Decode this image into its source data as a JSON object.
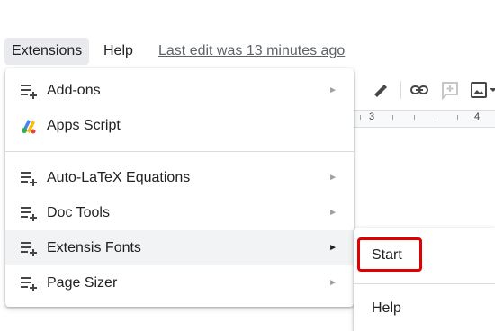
{
  "menubar": {
    "extensions": "Extensions",
    "help": "Help",
    "last_edit": "Last edit was 13 minutes ago"
  },
  "ruler": {
    "mark_3": "3",
    "mark_4": "4"
  },
  "menu": {
    "items": [
      {
        "label": "Add-ons",
        "icon": "add-ons-icon",
        "submenu": true
      },
      {
        "label": "Apps Script",
        "icon": "apps-script-icon",
        "submenu": false
      },
      {
        "label": "Auto-LaTeX Equations",
        "icon": "add-on-list-icon",
        "submenu": true
      },
      {
        "label": "Doc Tools",
        "icon": "add-on-list-icon",
        "submenu": true
      },
      {
        "label": "Extensis Fonts",
        "icon": "add-on-list-icon",
        "submenu": true,
        "highlighted": true
      },
      {
        "label": "Page Sizer",
        "icon": "add-on-list-icon",
        "submenu": true
      }
    ],
    "arrow": "►"
  },
  "submenu": {
    "items": [
      {
        "label": "Start",
        "outlined": true
      },
      {
        "label": "Help"
      }
    ]
  },
  "colors": {
    "highlight_outline": "#e00000",
    "hover_bg": "#f1f3f4",
    "active_menubar_bg": "#e8eaed"
  }
}
